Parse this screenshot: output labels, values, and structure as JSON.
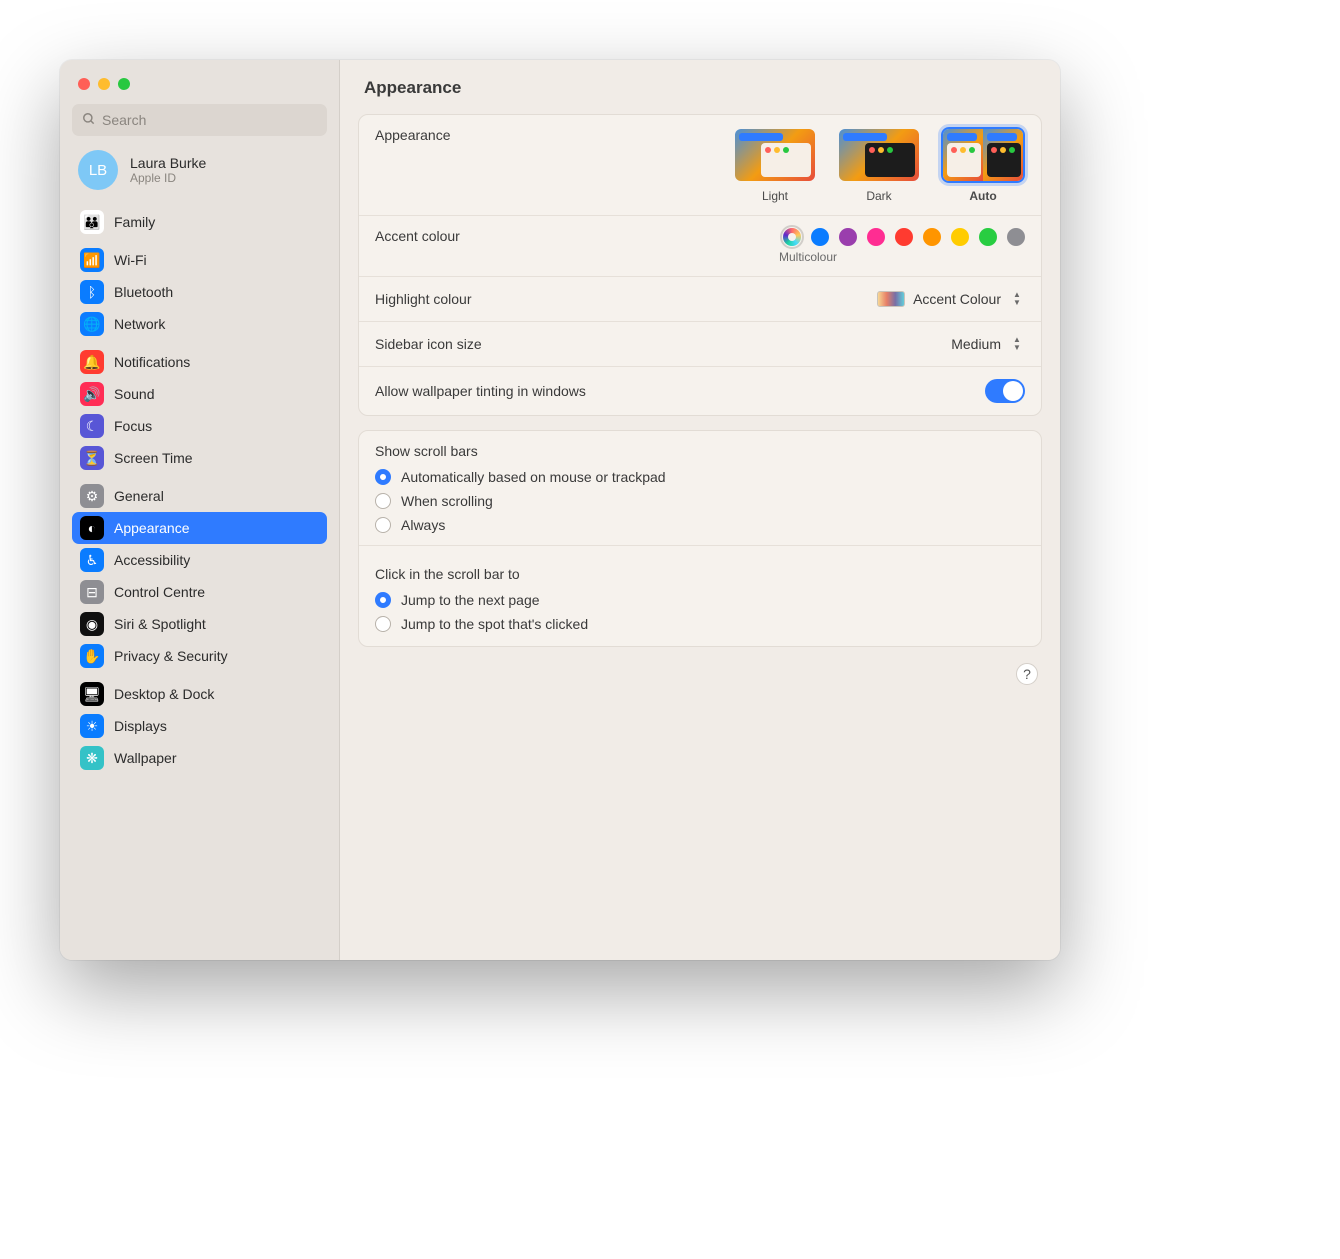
{
  "title": "Appearance",
  "search": {
    "placeholder": "Search"
  },
  "account": {
    "initials": "LB",
    "name": "Laura Burke",
    "sub": "Apple ID"
  },
  "sidebar": {
    "items": [
      {
        "label": "Family",
        "icon": "👪",
        "bg": "#ffffff"
      },
      {
        "label": "Wi-Fi",
        "icon": "📶",
        "bg": "#0a7cff"
      },
      {
        "label": "Bluetooth",
        "icon": "ᛒ",
        "bg": "#0a7cff"
      },
      {
        "label": "Network",
        "icon": "🌐",
        "bg": "#0a7cff"
      },
      {
        "label": "Notifications",
        "icon": "🔔",
        "bg": "#ff3b30"
      },
      {
        "label": "Sound",
        "icon": "🔊",
        "bg": "#ff2d55"
      },
      {
        "label": "Focus",
        "icon": "☾",
        "bg": "#5856d6"
      },
      {
        "label": "Screen Time",
        "icon": "⏳",
        "bg": "#5856d6"
      },
      {
        "label": "General",
        "icon": "⚙",
        "bg": "#8e8e93"
      },
      {
        "label": "Appearance",
        "icon": "◐",
        "bg": "#000000"
      },
      {
        "label": "Accessibility",
        "icon": "♿︎",
        "bg": "#0a7cff"
      },
      {
        "label": "Control Centre",
        "icon": "⊟",
        "bg": "#8e8e93"
      },
      {
        "label": "Siri & Spotlight",
        "icon": "◉",
        "bg": "#101010"
      },
      {
        "label": "Privacy & Security",
        "icon": "✋",
        "bg": "#0a7cff"
      },
      {
        "label": "Desktop & Dock",
        "icon": "🖥",
        "bg": "#000000"
      },
      {
        "label": "Displays",
        "icon": "☀",
        "bg": "#0a7cff"
      },
      {
        "label": "Wallpaper",
        "icon": "❋",
        "bg": "#34c2c7"
      }
    ],
    "selected": 9,
    "groups": [
      [
        0
      ],
      [
        1,
        2,
        3
      ],
      [
        4,
        5,
        6,
        7
      ],
      [
        8,
        9,
        10,
        11,
        12,
        13
      ],
      [
        14,
        15,
        16
      ]
    ]
  },
  "appearance": {
    "label": "Appearance",
    "options": [
      {
        "label": "Light"
      },
      {
        "label": "Dark"
      },
      {
        "label": "Auto"
      }
    ],
    "selected": 2
  },
  "accent": {
    "label": "Accent colour",
    "caption": "Multicolour",
    "colors": [
      "multi",
      "#0a7cff",
      "#9a3ead",
      "#ff2d92",
      "#ff3b30",
      "#ff9500",
      "#ffcc00",
      "#28cd41",
      "#8e8e93"
    ],
    "selected": 0
  },
  "highlight": {
    "label": "Highlight colour",
    "value": "Accent Colour"
  },
  "iconsize": {
    "label": "Sidebar icon size",
    "value": "Medium"
  },
  "tinting": {
    "label": "Allow wallpaper tinting in windows",
    "on": true
  },
  "scrollbars": {
    "label": "Show scroll bars",
    "options": [
      "Automatically based on mouse or trackpad",
      "When scrolling",
      "Always"
    ],
    "selected": 0
  },
  "scrollclick": {
    "label": "Click in the scroll bar to",
    "options": [
      "Jump to the next page",
      "Jump to the spot that's clicked"
    ],
    "selected": 0
  },
  "help": "?"
}
